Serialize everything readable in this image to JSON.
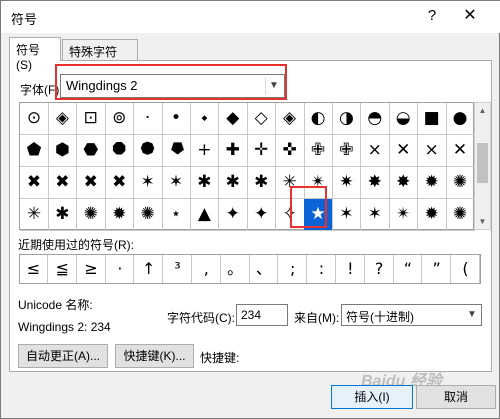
{
  "window": {
    "title": "符号",
    "help": "?",
    "close": "✕"
  },
  "tabs": [
    {
      "label": "符号(S)"
    },
    {
      "label": "特殊字符(P)"
    }
  ],
  "font": {
    "label": "字体(F):",
    "value": "Wingdings 2"
  },
  "grid": {
    "rows": [
      [
        "⊙",
        "◈",
        "⊡",
        "⊚",
        "·",
        "•",
        "⬩",
        "◆",
        "◇",
        "◈",
        "◐",
        "◑",
        "◓",
        "◒",
        "■",
        "●"
      ],
      [
        "⬟",
        "⬢",
        "⬣",
        "⯃",
        "⯄",
        "⯂",
        "+",
        "✚",
        "✛",
        "✜",
        "✙",
        "✙",
        "×",
        "✕",
        "×",
        "✕"
      ],
      [
        "✖",
        "✖",
        "✖",
        "✖",
        "✶",
        "✶",
        "✱",
        "✱",
        "✱",
        "✳",
        "✴",
        "✷",
        "✸",
        "✸",
        "✹",
        "✺"
      ],
      [
        "✳",
        "✱",
        "✺",
        "✹",
        "✺",
        "⋆",
        "▲",
        "✦",
        "✦",
        "✧",
        "★",
        "✶",
        "✶",
        "✴",
        "✹",
        "✺"
      ]
    ],
    "selected": {
      "row": 3,
      "col": 10
    }
  },
  "recent": {
    "label": "近期使用过的符号(R):",
    "symbols": [
      "≤",
      "≦",
      "≥",
      "·",
      "↑",
      "³",
      ",",
      "。",
      "、",
      ";",
      ":",
      "!",
      "?",
      "“",
      "”",
      "("
    ]
  },
  "unicode": {
    "label": "Unicode 名称:",
    "value": "Wingdings 2: 234"
  },
  "char_code": {
    "label": "字符代码(C):",
    "value": "234"
  },
  "from": {
    "label": "来自(M):",
    "value": "符号(十进制)"
  },
  "buttons": {
    "autocorrect": "自动更正(A)...",
    "shortcut_key": "快捷键(K)...",
    "shortcut_label": "快捷键:",
    "insert": "插入(I)",
    "cancel": "取消"
  },
  "watermark": "Baidu 经验",
  "colors": {
    "selection": "#0a64d8",
    "highlight": "#e8312f"
  }
}
